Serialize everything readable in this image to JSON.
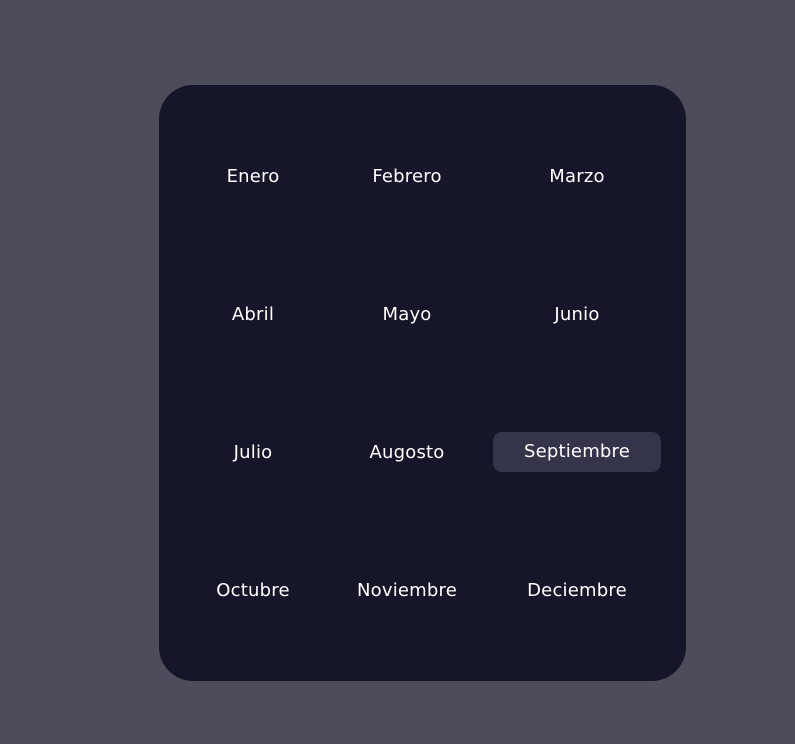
{
  "months": [
    {
      "label": "Enero"
    },
    {
      "label": "Febrero"
    },
    {
      "label": "Marzo"
    },
    {
      "label": "Abril"
    },
    {
      "label": "Mayo"
    },
    {
      "label": "Junio"
    },
    {
      "label": "Julio"
    },
    {
      "label": "Augosto"
    },
    {
      "label": "Septiembre"
    },
    {
      "label": "Octubre"
    },
    {
      "label": "Noviembre"
    },
    {
      "label": "Deciembre"
    }
  ],
  "selected_month": "Septiembre",
  "colors": {
    "page_background": "#4d4c5a",
    "panel_background": "#15162a",
    "selected_background": "#34344a",
    "text": "#ffffff"
  }
}
